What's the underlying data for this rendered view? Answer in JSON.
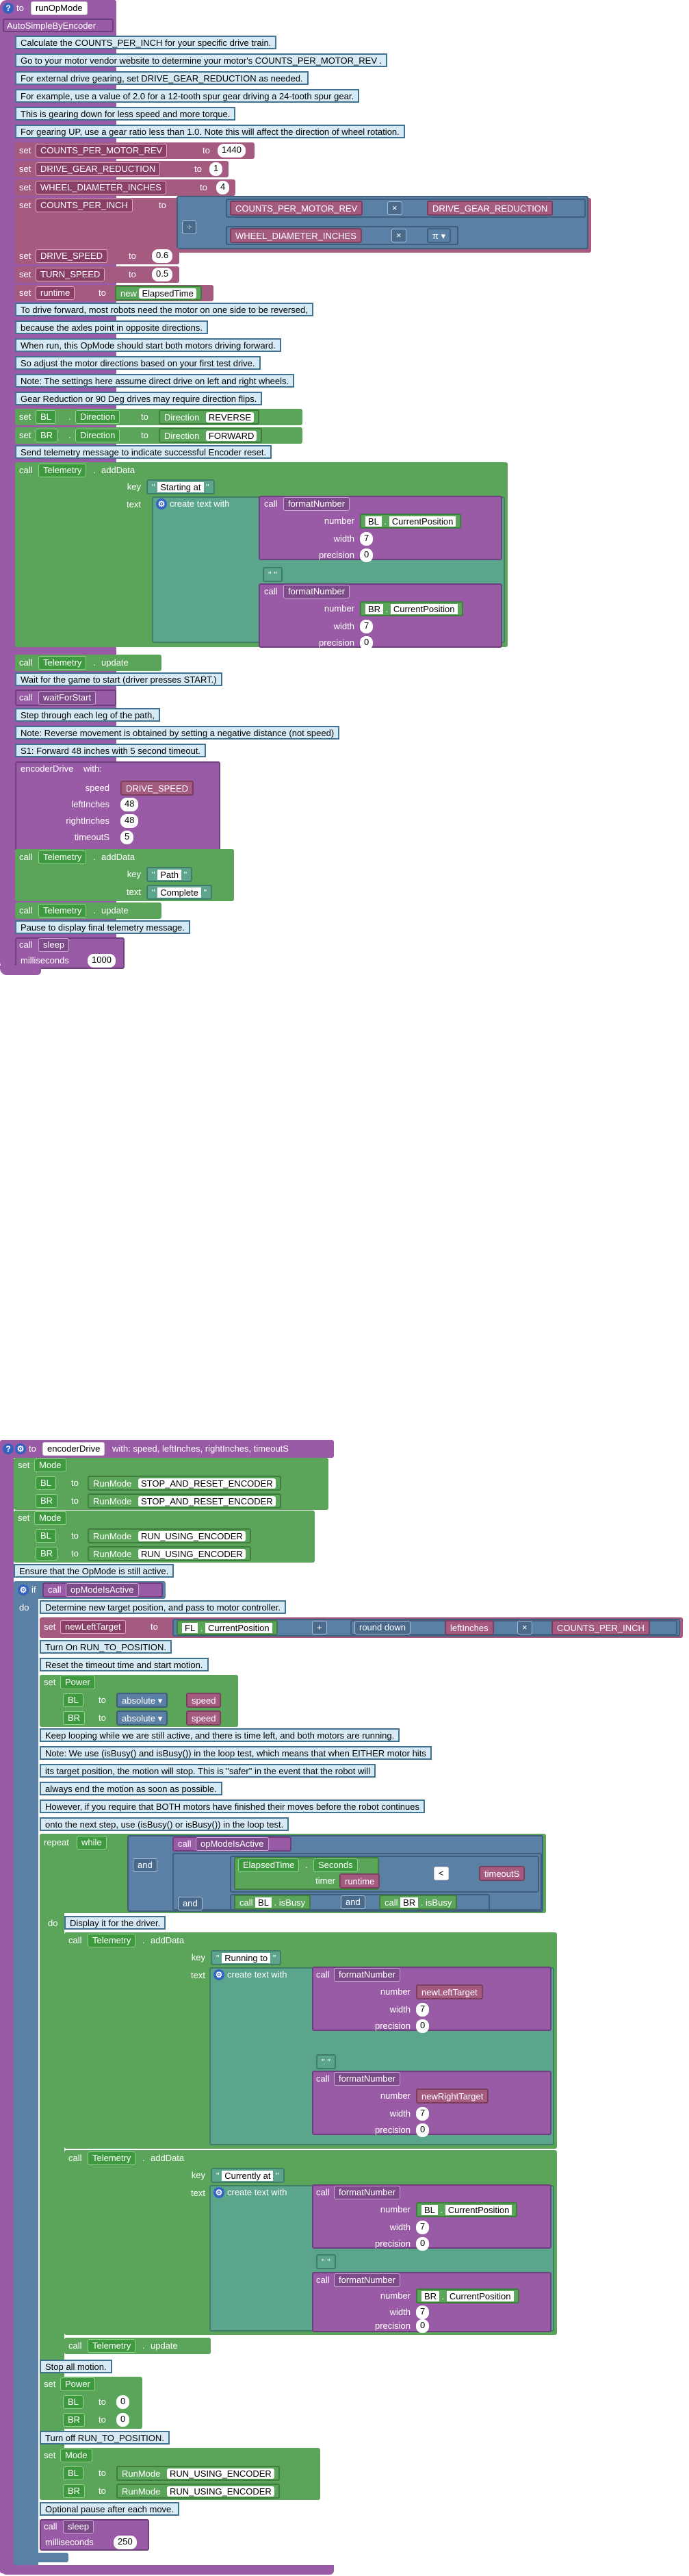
{
  "run_op_mode": {
    "to": "to",
    "name": "runOpMode",
    "opmode_label": "AutoSimpleByEncoder",
    "comments": [
      "Calculate the COUNTS_PER_INCH for your specific drive train.",
      "Go to your motor vendor website to determine your motor's COUNTS_PER_MOTOR_REV .",
      "For external drive gearing, set DRIVE_GEAR_REDUCTION as needed.",
      "For example, use a value of 2.0 for a 12-tooth spur gear driving a 24-tooth spur gear.",
      "This is gearing down for less speed and more torque.",
      "For gearing UP, use a gear ratio less than 1.0. Note this will affect the direction of wheel rotation."
    ],
    "set_label": "set",
    "to_label": "to",
    "vars": {
      "counts_per_motor_rev": "COUNTS_PER_MOTOR_REV",
      "counts_per_motor_rev_val": "1440",
      "drive_gear_reduction": "DRIVE_GEAR_REDUCTION",
      "drive_gear_reduction_val": "1",
      "wheel_diameter_inches": "WHEEL_DIAMETER_INCHES",
      "wheel_diameter_inches_val": "4",
      "counts_per_inch": "COUNTS_PER_INCH",
      "drive_speed": "DRIVE_SPEED",
      "drive_speed_val": "0.6",
      "turn_speed": "TURN_SPEED",
      "turn_speed_val": "0.5",
      "runtime": "runtime",
      "new_label": "new",
      "elapsed_time": "ElapsedTime"
    },
    "ops": {
      "times": "×",
      "divide": "÷",
      "pi": "π"
    },
    "comments2": [
      "To drive forward, most robots need the motor on one side to be reversed,",
      "because the axles point in opposite directions.",
      "When run, this OpMode should start both motors driving forward.",
      "So adjust the motor directions based on your first test drive.",
      "Note: The settings here assume direct drive on left and right wheels.",
      "Gear Reduction or 90 Deg drives may require direction flips."
    ],
    "motors": {
      "bl": "BL",
      "br": "BR",
      "direction": "Direction",
      "reverse": "REVERSE",
      "forward": "FORWARD"
    },
    "comment_telemetry": "Send telemetry message to indicate successful Encoder reset.",
    "call_label": "call",
    "telemetry": "Telemetry",
    "add_data": "addData",
    "key_label": "key",
    "text_label": "text",
    "starting_at": "Starting at",
    "create_text_with": "create text with",
    "format_number": "formatNumber",
    "number_label": "number",
    "width_label": "width",
    "precision_label": "precision",
    "current_position": "CurrentPosition",
    "width_val": "7",
    "precision_val": "0",
    "space_str": "\" \"",
    "update": "update",
    "comment_wait": "Wait for the game to start (driver presses START.)",
    "wait_for_start": "waitForStart",
    "comments3": [
      "Step through each leg of the path,",
      "Note: Reverse movement is obtained by setting a negative distance (not speed)",
      "S1: Forward 48 inches with 5 second timeout."
    ],
    "encoder_drive": "encoderDrive",
    "with_label": "with:",
    "speed_label": "speed",
    "left_inches_label": "leftInches",
    "right_inches_label": "rightInches",
    "timeout_label": "timeoutS",
    "left_val": "48",
    "right_val": "48",
    "timeout_val": "5",
    "path": "Path",
    "complete": "Complete",
    "comment_pause": "Pause to display final telemetry message.",
    "sleep": "sleep",
    "milliseconds_label": "milliseconds",
    "ms_val": "1000"
  },
  "encoder_drive_fn": {
    "to": "to",
    "name": "encoderDrive",
    "params": "with: speed, leftInches, rightInches, timeoutS",
    "set_label": "set",
    "to_label": "to",
    "mode": "Mode",
    "run_mode": "RunMode",
    "stop_and_reset": "STOP_AND_RESET_ENCODER",
    "run_using": "RUN_USING_ENCODER",
    "comment_active": "Ensure that the OpMode is still active.",
    "if_label": "if",
    "do_label": "do",
    "call_label": "call",
    "op_mode_is_active": "opModeIsActive",
    "comment_target": "Determine new target position, and pass to motor controller.",
    "new_left_target": "newLeftTarget",
    "fl": "FL",
    "current_position": "CurrentPosition",
    "plus": "+",
    "round_down": "round down",
    "left_inches": "leftInches",
    "times": "×",
    "counts_per_inch": "COUNTS_PER_INCH",
    "comment_run_to": "Turn On RUN_TO_POSITION.",
    "comment_reset": "Reset the timeout time and start motion.",
    "power": "Power",
    "bl": "BL",
    "br": "BR",
    "absolute": "absolute",
    "speed": "speed",
    "comments_loop": [
      "Keep looping while we are still active, and there is time left, and both motors are running.",
      "Note: We use (isBusy() and isBusy()) in the loop test, which means that when EITHER motor hits",
      "its target position, the motion will stop.  This is \"safer\" in the event that the robot will",
      "always end the motion as soon as possible.",
      "However, if you require that BOTH motors have finished their moves before the robot continues",
      "onto the next step, use (isBusy() or isBusy()) in the loop test."
    ],
    "repeat_label": "repeat",
    "while_label": "while",
    "and_label": "and",
    "elapsed_time": "ElapsedTime",
    "seconds": "Seconds",
    "timer_label": "timer",
    "runtime": "runtime",
    "lt": "<",
    "timeout_s": "timeoutS",
    "is_busy": "isBusy",
    "comment_display": "Display it for the driver.",
    "telemetry": "Telemetry",
    "add_data": "addData",
    "key_label": "key",
    "text_label": "text",
    "running_to": "Running to",
    "currently_at": "Currently at",
    "create_text_with": "create text with",
    "format_number": "formatNumber",
    "number_label": "number",
    "width_label": "width",
    "precision_label": "precision",
    "width_val": "7",
    "precision_val": "0",
    "new_right_target": "newRightTarget",
    "space_str": "\" \"",
    "update": "update",
    "comment_stop": "Stop all motion.",
    "zero": "0",
    "comment_turn_off": "Turn off RUN_TO_POSITION.",
    "comment_pause": "Optional pause after each move.",
    "sleep": "sleep",
    "milliseconds_label": "milliseconds",
    "ms_val": "250"
  }
}
